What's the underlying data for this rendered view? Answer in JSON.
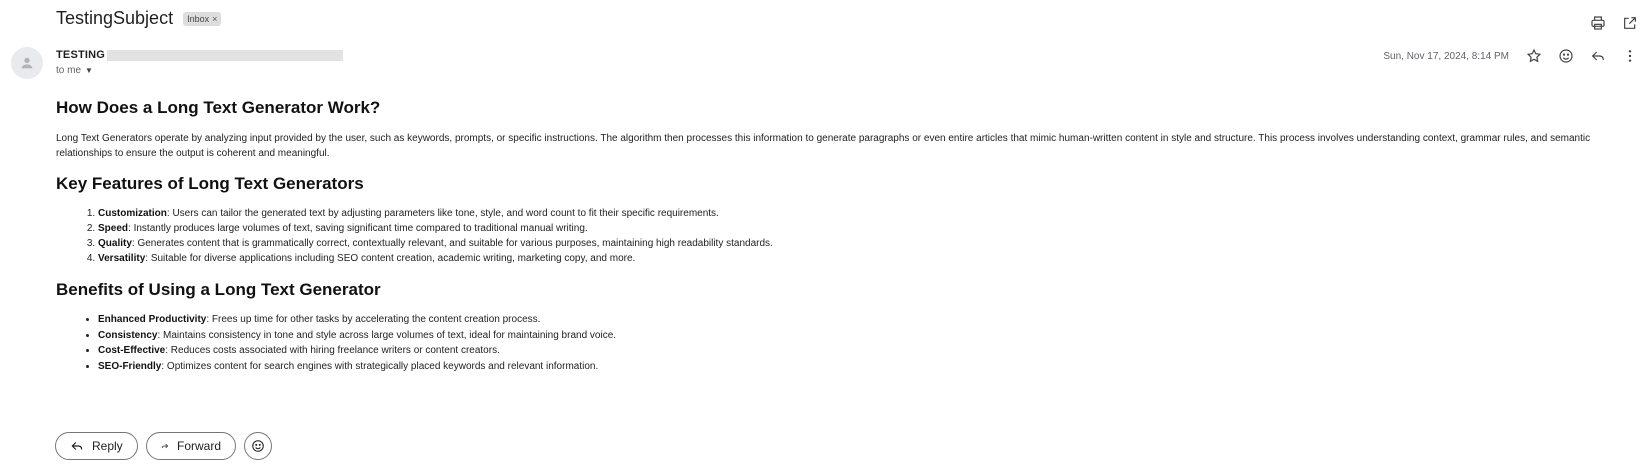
{
  "email": {
    "subject": "TestingSubject",
    "label": "Inbox",
    "label_remove": "×",
    "sender_name": "TESTING",
    "to_text": "to me",
    "date": "Sun, Nov 17, 2024, 8:14 PM"
  },
  "icons": {
    "print": "print-icon",
    "open_new_window": "open-in-new-window-icon",
    "star": "star-icon",
    "emoji": "emoji-icon",
    "reply": "reply-icon",
    "more": "more-vert-icon",
    "forward": "forward-icon",
    "avatar": "person-icon"
  },
  "body": {
    "heading1": "How Does a Long Text Generator Work?",
    "paragraph": "Long Text Generators operate by analyzing input provided by the user, such as keywords, prompts, or specific instructions. The algorithm then processes this information to generate paragraphs or even entire articles that mimic human-written content in style and structure. This process involves understanding context, grammar rules, and semantic relationships to ensure the output is coherent and meaningful.",
    "heading2": "Key Features of Long Text Generators",
    "features": [
      {
        "term": "Customization",
        "text": ": Users can tailor the generated text by adjusting parameters like tone, style, and word count to fit their specific requirements."
      },
      {
        "term": "Speed",
        "text": ": Instantly produces large volumes of text, saving significant time compared to traditional manual writing."
      },
      {
        "term": "Quality",
        "text": ": Generates content that is grammatically correct, contextually relevant, and suitable for various purposes, maintaining high readability standards."
      },
      {
        "term": "Versatility",
        "text": ": Suitable for diverse applications including SEO content creation, academic writing, marketing copy, and more."
      }
    ],
    "heading3": "Benefits of Using a Long Text Generator",
    "benefits": [
      {
        "term": "Enhanced Productivity",
        "text": ": Frees up time for other tasks by accelerating the content creation process."
      },
      {
        "term": "Consistency",
        "text": ": Maintains consistency in tone and style across large volumes of text, ideal for maintaining brand voice."
      },
      {
        "term": "Cost-Effective",
        "text": ": Reduces costs associated with hiring freelance writers or content creators."
      },
      {
        "term": "SEO-Friendly",
        "text": ": Optimizes content for search engines with strategically placed keywords and relevant information."
      }
    ]
  },
  "actions": {
    "reply_label": "Reply",
    "forward_label": "Forward"
  }
}
